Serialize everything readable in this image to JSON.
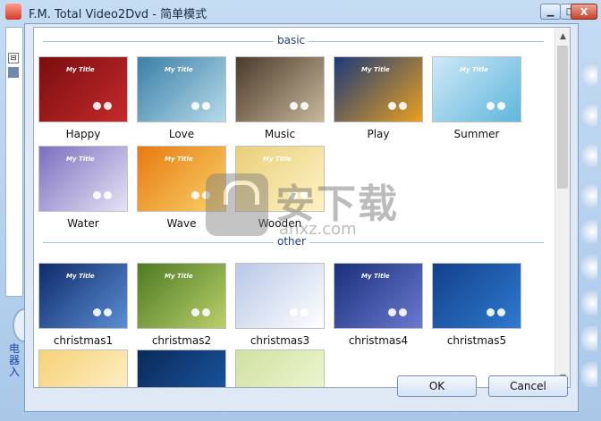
{
  "window": {
    "title": "F.M. Total Video2Dvd - 简单模式",
    "controls": [
      "minimize-icon",
      "maximize-icon",
      "close-icon"
    ],
    "close_glyph": "X"
  },
  "background_app": {
    "side_chars": "电器入"
  },
  "dialog": {
    "sections": [
      {
        "label": "basic",
        "items": [
          {
            "caption": "Happy",
            "thumb_text": "My Title",
            "colors": [
              "#7a0d0f",
              "#c42a2b"
            ]
          },
          {
            "caption": "Love",
            "thumb_text": "My Title",
            "colors": [
              "#3a7fa8",
              "#b7dbe8"
            ]
          },
          {
            "caption": "Music",
            "thumb_text": "",
            "colors": [
              "#4a3a2a",
              "#c8b89c"
            ]
          },
          {
            "caption": "Play",
            "thumb_text": "My Title",
            "colors": [
              "#1c3a78",
              "#e8a020"
            ]
          },
          {
            "caption": "Summer",
            "thumb_text": "My Title",
            "colors": [
              "#cfe9f7",
              "#5fb6dc"
            ]
          },
          {
            "caption": "Water",
            "thumb_text": "My Title",
            "colors": [
              "#7c6fbf",
              "#e6e3f6"
            ]
          },
          {
            "caption": "Wave",
            "thumb_text": "My Title",
            "colors": [
              "#e87a10",
              "#f8d26a"
            ]
          },
          {
            "caption": "Wooden",
            "thumb_text": "My Title",
            "colors": [
              "#e8cf7a",
              "#fff3c4"
            ]
          }
        ]
      },
      {
        "label": "other",
        "items": [
          {
            "caption": "christmas1",
            "thumb_text": "My Title",
            "colors": [
              "#0f2a6a",
              "#5b8fd4"
            ]
          },
          {
            "caption": "christmas2",
            "thumb_text": "My Title",
            "colors": [
              "#4e7a22",
              "#b9d06a"
            ]
          },
          {
            "caption": "christmas3",
            "thumb_text": "",
            "colors": [
              "#b8c8e8",
              "#ffffff"
            ]
          },
          {
            "caption": "christmas4",
            "thumb_text": "My Title",
            "colors": [
              "#1b2f7a",
              "#6a7ad0"
            ]
          },
          {
            "caption": "christmas5",
            "thumb_text": "",
            "colors": [
              "#13408a",
              "#2e7ad0"
            ]
          }
        ]
      }
    ],
    "partial_row_colors": [
      [
        "#f6d27a",
        "#fff3d0"
      ],
      [
        "#0a2a5a",
        "#1c5aa8"
      ],
      [
        "#cfe2a2",
        "#f2f8d8"
      ]
    ],
    "ok_label": "OK",
    "cancel_label": "Cancel",
    "scroll_up_icon": "chevron-up-icon",
    "scroll_down_icon": "chevron-down-icon"
  },
  "watermark": {
    "text": "安下载",
    "url": "anxz.com"
  }
}
